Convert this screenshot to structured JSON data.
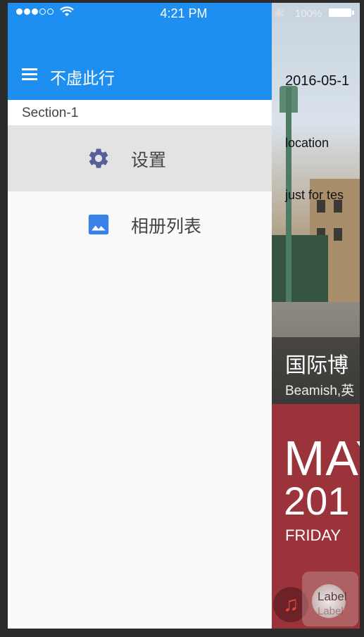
{
  "status_bar": {
    "time": "4:21 PM",
    "battery_label": "100%",
    "icons": [
      "signal-dots-icon",
      "wifi-icon",
      "bluetooth-icon",
      "battery-icon"
    ]
  },
  "drawer": {
    "title": "不虚此行",
    "section_label": "Section-1",
    "items": [
      {
        "label": "设置",
        "icon": "gear-icon",
        "selected": true
      },
      {
        "label": "相册列表",
        "icon": "image-icon",
        "selected": false
      }
    ]
  },
  "card": {
    "date": "2016-05-1",
    "location": "location",
    "note": "just for tes",
    "title": "国际博",
    "subtitle": "Beamish,英",
    "calendar": {
      "month": "MAY",
      "year": "201",
      "day": "FRIDAY"
    },
    "float_label": "Label",
    "float_label_2": "Label"
  },
  "colors": {
    "header": "#1e8ff0",
    "gear_icon": "#5a5f9a",
    "image_icon": "#3b82e8",
    "calendar_bg": "#9b333a"
  }
}
